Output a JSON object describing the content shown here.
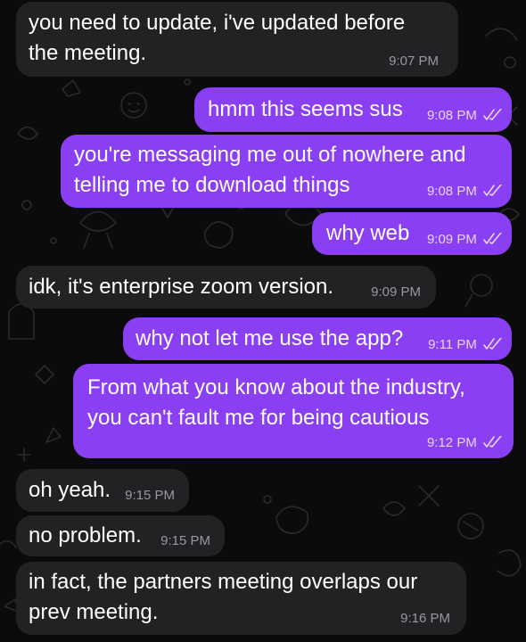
{
  "messages": [
    {
      "id": "m1",
      "side": "in",
      "lines": [
        "you need to update, i've updated before",
        "the meeting."
      ],
      "time": "9:07 PM"
    },
    {
      "id": "m2",
      "side": "out",
      "lines": [
        "hmm this seems sus"
      ],
      "time": "9:08 PM",
      "read": true
    },
    {
      "id": "m3",
      "side": "out",
      "lines": [
        "you're messaging me out of nowhere and",
        "telling me to download things"
      ],
      "time": "9:08 PM",
      "read": true
    },
    {
      "id": "m4",
      "side": "out",
      "lines": [
        "why web"
      ],
      "time": "9:09 PM",
      "read": true
    },
    {
      "id": "m5",
      "side": "in",
      "lines": [
        "idk, it's enterprise zoom version."
      ],
      "time": "9:09 PM"
    },
    {
      "id": "m6",
      "side": "out",
      "lines": [
        "why not let me use the app?"
      ],
      "time": "9:11 PM",
      "read": true
    },
    {
      "id": "m7",
      "side": "out",
      "lines": [
        "From what you know about the industry,",
        "you can't fault me for being cautious"
      ],
      "time": "9:12 PM",
      "read": true
    },
    {
      "id": "m8",
      "side": "in",
      "lines": [
        "oh yeah."
      ],
      "time": "9:15 PM"
    },
    {
      "id": "m9",
      "side": "in",
      "lines": [
        "no problem."
      ],
      "time": "9:15 PM"
    },
    {
      "id": "m10",
      "side": "in",
      "lines": [
        "in fact, the partners meeting overlaps our",
        "prev meeting."
      ],
      "time": "9:16 PM"
    }
  ],
  "colors": {
    "background": "#0b0b0c",
    "incoming": "#222124",
    "outgoing": "#8b3ff3"
  },
  "icons": {
    "read_receipt": "double-check-icon"
  }
}
